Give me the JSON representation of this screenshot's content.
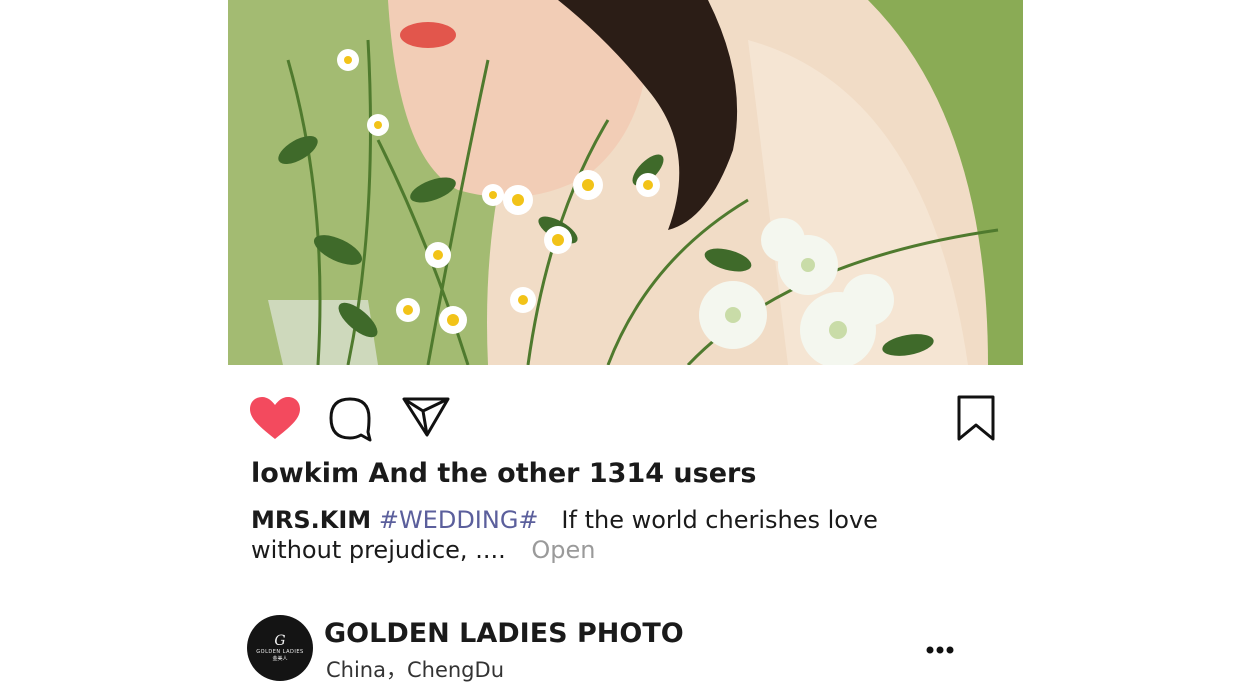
{
  "post": {
    "likes_text": "lowkim And the other 1314 users",
    "caption": {
      "user": "MRS.KIM",
      "hashtag": "#WEDDING#",
      "text": "If the world cherishes love without prejudice, ....",
      "open_label": "Open"
    }
  },
  "actions": {
    "like_icon": "heart-filled-icon",
    "comment_icon": "comment-icon",
    "share_icon": "paper-plane-icon",
    "save_icon": "bookmark-icon",
    "like_color": "#f34a5e"
  },
  "account": {
    "name": "GOLDEN LADIES PHOTO",
    "location": "China，ChengDu",
    "avatar_logo": {
      "monogram": "G",
      "brand": "GOLDEN LADIES",
      "sub": "金美人"
    },
    "more_icon": "more-dots-icon"
  }
}
